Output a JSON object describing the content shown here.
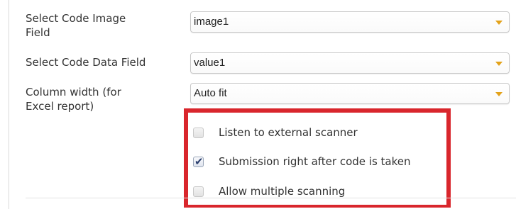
{
  "fields": [
    {
      "label": "Select Code Image\nField",
      "value": "image1"
    },
    {
      "label": "Select Code Data Field",
      "value": "value1"
    },
    {
      "label": "Column width (for\nExcel report)",
      "value": "Auto fit"
    }
  ],
  "options": [
    {
      "label": "Listen to external scanner",
      "checked": false
    },
    {
      "label": "Submission right after code is taken",
      "checked": true
    },
    {
      "label": "Allow multiple scanning",
      "checked": false
    }
  ],
  "icons": {
    "dropdown": "chevron-down-icon",
    "check": "checkmark-icon"
  },
  "colors": {
    "highlight_border": "#d9262c",
    "dropdown_caret": "#e3a21a",
    "checkmark": "#2b3f6e"
  }
}
